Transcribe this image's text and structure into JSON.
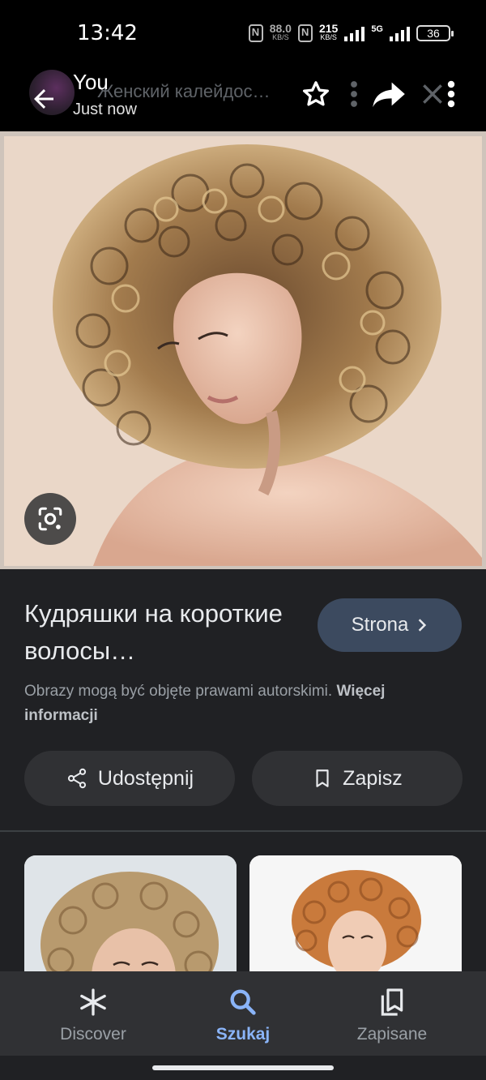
{
  "status_bar": {
    "time": "13:42",
    "speed1_value": "88.0",
    "speed1_unit": "KB/S",
    "speed2_value": "215",
    "speed2_unit": "KB/S",
    "network": "5G",
    "battery": "36"
  },
  "top_bar": {
    "author": "You",
    "timestamp": "Just now",
    "background_title": "Женский калейдос…"
  },
  "result": {
    "title": "Кудряшки на короткие волосы…",
    "visit_button": "Strona",
    "copyright_text": "Obrazy mogą być objęte prawami autorskimi.",
    "more_info_link": "Więcej informacji",
    "share_button": "Udostępnij",
    "save_button": "Zapisz"
  },
  "bottom_nav": {
    "items": [
      {
        "label": "Discover",
        "icon": "asterisk-icon",
        "active": false
      },
      {
        "label": "Szukaj",
        "icon": "search-icon",
        "active": true
      },
      {
        "label": "Zapisane",
        "icon": "collections-bookmark-icon",
        "active": false
      }
    ]
  },
  "colors": {
    "background": "#202124",
    "accent": "#8ab4f8",
    "button": "#303134",
    "primary_button": "#3c4a5f"
  }
}
